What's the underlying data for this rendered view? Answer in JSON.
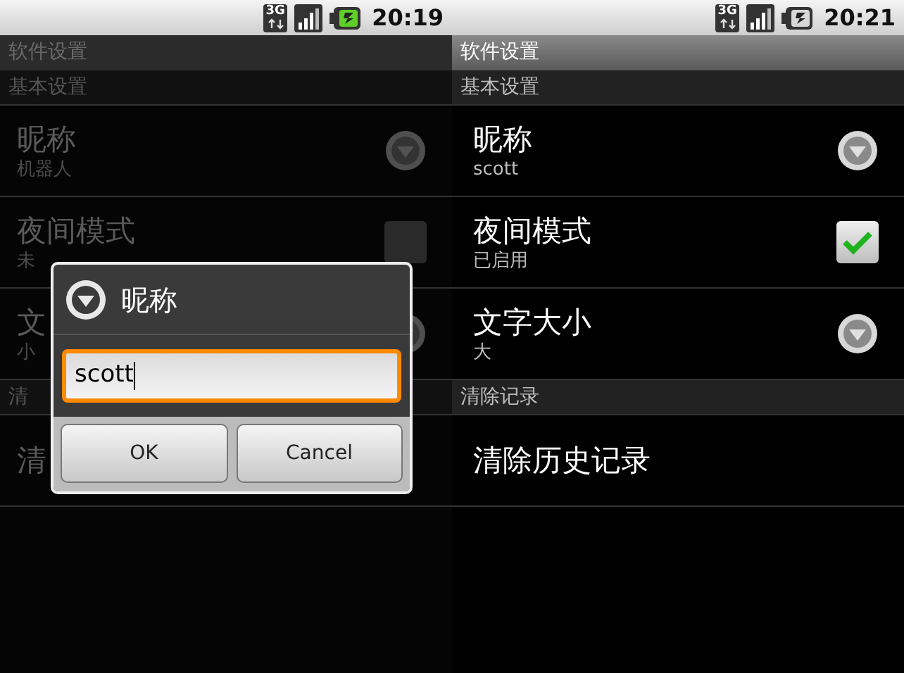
{
  "screens": [
    {
      "dimmed": true,
      "status_bar": {
        "network": "3G",
        "time": "20:19"
      },
      "title": "软件设置",
      "groups": [
        {
          "header": "基本设置",
          "items": [
            {
              "kind": "list",
              "title": "昵称",
              "summary": "机器人"
            },
            {
              "kind": "checkbox",
              "title": "夜间模式",
              "summary": "未",
              "checked": false
            },
            {
              "kind": "list",
              "title": "文",
              "summary": "小"
            }
          ]
        },
        {
          "header": "清",
          "items": [
            {
              "kind": "plain",
              "title": "清"
            }
          ]
        }
      ],
      "dialog": {
        "title": "昵称",
        "value": "scott",
        "buttons": [
          "OK",
          "Cancel"
        ]
      }
    },
    {
      "dimmed": false,
      "status_bar": {
        "network": "3G",
        "time": "20:21"
      },
      "title": "软件设置",
      "groups": [
        {
          "header": "基本设置",
          "items": [
            {
              "kind": "list",
              "title": "昵称",
              "summary": "scott"
            },
            {
              "kind": "checkbox",
              "title": "夜间模式",
              "summary": "已启用",
              "checked": true
            },
            {
              "kind": "list",
              "title": "文字大小",
              "summary": "大"
            }
          ]
        },
        {
          "header": "清除记录",
          "items": [
            {
              "kind": "plain",
              "title": "清除历史记录"
            }
          ]
        }
      ]
    }
  ]
}
